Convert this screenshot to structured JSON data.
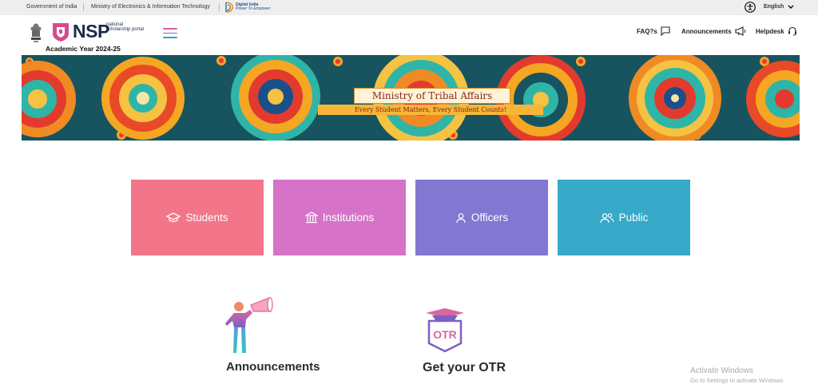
{
  "gov_bar": {
    "government": "Government of India",
    "ministry": "Ministry of Electronics & Information Technology",
    "digital_india_1": "Digital India",
    "digital_india_2": "Power To Empower",
    "language": "English",
    "icons": {
      "accessibility": "accessibility-icon",
      "chevron": "chevron-down-icon"
    }
  },
  "header": {
    "logo_text": "NSP",
    "logo_sub": "national scholarship portal",
    "academic_year": "Academic Year 2024-25",
    "links": [
      {
        "label": "FAQ?s",
        "icon": "chat-icon"
      },
      {
        "label": "Announcements",
        "icon": "megaphone-icon"
      },
      {
        "label": "Helpdesk",
        "icon": "headset-icon"
      }
    ]
  },
  "banner": {
    "title": "Ministry of Tribal Affairs",
    "subtitle": "Every Student Matters, Every Student Counts!"
  },
  "tiles": [
    {
      "label": "Students",
      "icon": "graduation-cap-icon",
      "color": "#f2758a"
    },
    {
      "label": "Institutions",
      "icon": "institution-icon",
      "color": "#d673c8"
    },
    {
      "label": "Officers",
      "icon": "user-icon",
      "color": "#8278d2"
    },
    {
      "label": "Public",
      "icon": "users-icon",
      "color": "#37a9c9"
    }
  ],
  "cards": [
    {
      "title": "Announcements",
      "icon": "announcer-icon"
    },
    {
      "title": "Get your OTR",
      "badge": "OTR",
      "icon": "otr-icon"
    }
  ],
  "watermark": {
    "line1": "Activate Windows",
    "line2": "Go to Settings to activate Windows."
  },
  "colors": {
    "gov_bar_bg": "#eeeeee",
    "brand_navy": "#1e2a4a",
    "brand_pink": "#d84a8c"
  }
}
